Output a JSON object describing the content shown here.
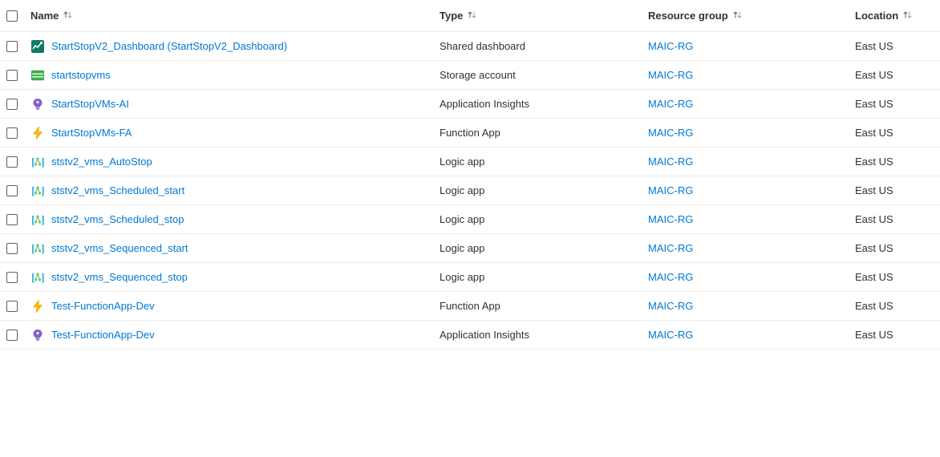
{
  "headers": {
    "name": "Name",
    "type": "Type",
    "resource_group": "Resource group",
    "location": "Location"
  },
  "rows": [
    {
      "icon": "dashboard",
      "name": "StartStopV2_Dashboard (StartStopV2_Dashboard)",
      "type": "Shared dashboard",
      "rg": "MAIC-RG",
      "location": "East US"
    },
    {
      "icon": "storage",
      "name": "startstopvms",
      "type": "Storage account",
      "rg": "MAIC-RG",
      "location": "East US"
    },
    {
      "icon": "appinsights",
      "name": "StartStopVMs-AI",
      "type": "Application Insights",
      "rg": "MAIC-RG",
      "location": "East US"
    },
    {
      "icon": "functionapp",
      "name": "StartStopVMs-FA",
      "type": "Function App",
      "rg": "MAIC-RG",
      "location": "East US"
    },
    {
      "icon": "logicapp",
      "name": "ststv2_vms_AutoStop",
      "type": "Logic app",
      "rg": "MAIC-RG",
      "location": "East US"
    },
    {
      "icon": "logicapp",
      "name": "ststv2_vms_Scheduled_start",
      "type": "Logic app",
      "rg": "MAIC-RG",
      "location": "East US"
    },
    {
      "icon": "logicapp",
      "name": "ststv2_vms_Scheduled_stop",
      "type": "Logic app",
      "rg": "MAIC-RG",
      "location": "East US"
    },
    {
      "icon": "logicapp",
      "name": "ststv2_vms_Sequenced_start",
      "type": "Logic app",
      "rg": "MAIC-RG",
      "location": "East US"
    },
    {
      "icon": "logicapp",
      "name": "ststv2_vms_Sequenced_stop",
      "type": "Logic app",
      "rg": "MAIC-RG",
      "location": "East US"
    },
    {
      "icon": "functionapp",
      "name": "Test-FunctionApp-Dev",
      "type": "Function App",
      "rg": "MAIC-RG",
      "location": "East US"
    },
    {
      "icon": "appinsights",
      "name": "Test-FunctionApp-Dev",
      "type": "Application Insights",
      "rg": "MAIC-RG",
      "location": "East US"
    }
  ]
}
